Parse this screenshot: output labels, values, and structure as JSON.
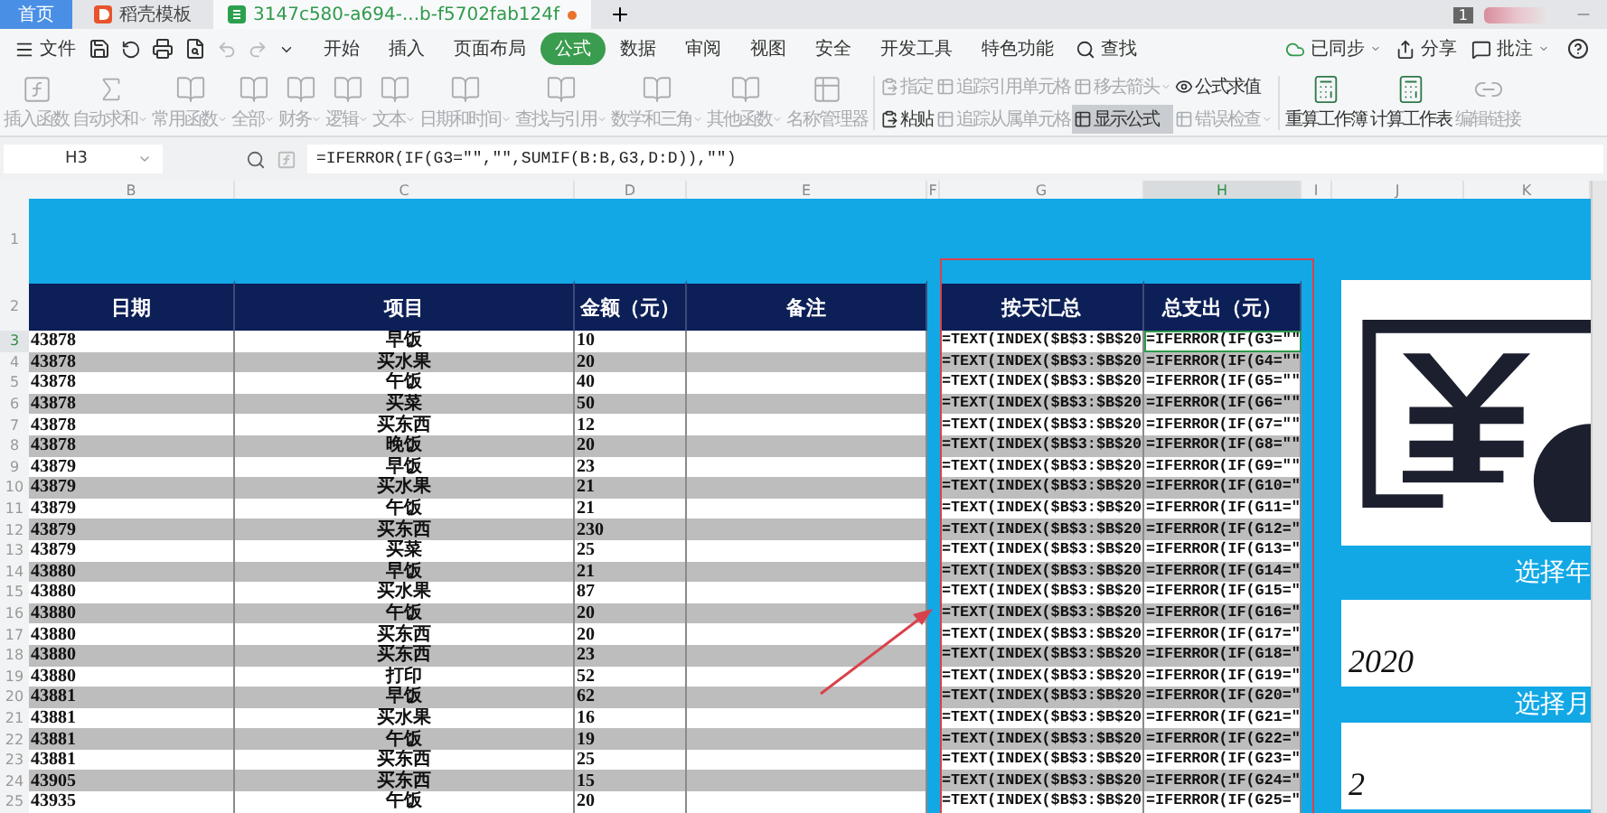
{
  "tabs": [
    {
      "label": "首页",
      "kind": "home",
      "selected": false
    },
    {
      "label": "稻壳模板",
      "kind": "docer",
      "selected": false
    },
    {
      "label": "3147c580-a694-...b-f5702fab124f",
      "kind": "sheet",
      "selected": true
    }
  ],
  "notification_count": "1",
  "menu": {
    "file": "文件",
    "items": [
      {
        "label": "开始",
        "selected": false
      },
      {
        "label": "插入",
        "selected": false
      },
      {
        "label": "页面布局",
        "selected": false
      },
      {
        "label": "公式",
        "selected": true
      },
      {
        "label": "数据",
        "selected": false
      },
      {
        "label": "审阅",
        "selected": false
      },
      {
        "label": "视图",
        "selected": false
      },
      {
        "label": "安全",
        "selected": false
      },
      {
        "label": "开发工具",
        "selected": false
      },
      {
        "label": "特色功能",
        "selected": false
      }
    ],
    "search": "查找",
    "sync": "已同步",
    "share": "分享",
    "comment": "批注"
  },
  "ribbon": [
    {
      "kind": "function",
      "label": "插入函数",
      "dropdown": false,
      "disabled": true
    },
    {
      "kind": "sum",
      "label": "自动求和",
      "dropdown": true,
      "disabled": true
    },
    {
      "kind": "category",
      "label": "常用函数",
      "dropdown": true,
      "disabled": true
    },
    {
      "kind": "category",
      "label": "全部",
      "dropdown": true,
      "disabled": true
    },
    {
      "kind": "category",
      "label": "财务",
      "dropdown": true,
      "disabled": true
    },
    {
      "kind": "category",
      "label": "逻辑",
      "dropdown": true,
      "disabled": true
    },
    {
      "kind": "category",
      "label": "文本",
      "dropdown": true,
      "disabled": true
    },
    {
      "kind": "category",
      "label": "日期和时间",
      "dropdown": true,
      "disabled": true
    },
    {
      "kind": "category",
      "label": "查找与引用",
      "dropdown": true,
      "disabled": true
    },
    {
      "kind": "category",
      "label": "数学和三角",
      "dropdown": true,
      "disabled": true
    },
    {
      "kind": "category",
      "label": "其他函数",
      "dropdown": true,
      "disabled": true
    },
    {
      "kind": "manager",
      "label": "名称管理器",
      "dropdown": false,
      "disabled": true
    }
  ],
  "ribbon_small": [
    [
      {
        "label": "指定",
        "dropdown": false,
        "disabled": true,
        "on": false
      },
      {
        "label": "粘贴",
        "dropdown": false,
        "disabled": false,
        "on": false
      }
    ],
    [
      {
        "label": "追踪引用单元格",
        "dropdown": false,
        "disabled": true,
        "on": false
      },
      {
        "label": "追踪从属单元格",
        "dropdown": false,
        "disabled": true,
        "on": false
      }
    ],
    [
      {
        "label": "移去箭头",
        "dropdown": true,
        "disabled": true,
        "on": false
      },
      {
        "label": "显示公式",
        "dropdown": false,
        "disabled": false,
        "on": true
      }
    ],
    [
      {
        "label": "公式求值",
        "dropdown": false,
        "disabled": false,
        "on": false
      },
      {
        "label": "错误检查",
        "dropdown": true,
        "disabled": true,
        "on": false
      }
    ]
  ],
  "ribbon_end": [
    {
      "kind": "recalc",
      "label": "重算工作簿",
      "dropdown": false,
      "disabled": false
    },
    {
      "kind": "recalc",
      "label": "计算工作表",
      "dropdown": false,
      "disabled": false
    },
    {
      "kind": "link",
      "label": "编辑链接",
      "dropdown": false,
      "disabled": true
    }
  ],
  "formula_bar": {
    "cell": "H3",
    "formula": "=IFERROR(IF(G3=\"\",\"\",SUMIF(B:B,G3,D:D)),\"\")"
  },
  "columns": [
    {
      "label": "B",
      "selected": false
    },
    {
      "label": "C",
      "selected": false
    },
    {
      "label": "D",
      "selected": false
    },
    {
      "label": "E",
      "selected": false
    },
    {
      "label": "F",
      "selected": false
    },
    {
      "label": "G",
      "selected": false
    },
    {
      "label": "H",
      "selected": true
    },
    {
      "label": "I",
      "selected": false
    },
    {
      "label": "J",
      "selected": false
    },
    {
      "label": "K",
      "selected": false
    }
  ],
  "top_rows": [
    "1",
    "2"
  ],
  "headers": [
    "日期",
    "项目",
    "金额（元）",
    "备注"
  ],
  "summary_headers": [
    "按天汇总",
    "总支出（元）"
  ],
  "rows": [
    {
      "number": "3",
      "date": "43878",
      "item": "早饭",
      "amount": "10",
      "day": "=TEXT(INDEX($B$3:$B$20",
      "total": "=IFERROR(IF(G3=\"\"",
      "selected": true
    },
    {
      "number": "4",
      "date": "43878",
      "item": "买水果",
      "amount": "20",
      "day": "=TEXT(INDEX($B$3:$B$20",
      "total": "=IFERROR(IF(G4=\"\"",
      "selected": false
    },
    {
      "number": "5",
      "date": "43878",
      "item": "午饭",
      "amount": "40",
      "day": "=TEXT(INDEX($B$3:$B$20",
      "total": "=IFERROR(IF(G5=\"\"",
      "selected": false
    },
    {
      "number": "6",
      "date": "43878",
      "item": "买菜",
      "amount": "50",
      "day": "=TEXT(INDEX($B$3:$B$20",
      "total": "=IFERROR(IF(G6=\"\"",
      "selected": false
    },
    {
      "number": "7",
      "date": "43878",
      "item": "买东西",
      "amount": "12",
      "day": "=TEXT(INDEX($B$3:$B$20",
      "total": "=IFERROR(IF(G7=\"\"",
      "selected": false
    },
    {
      "number": "8",
      "date": "43878",
      "item": "晚饭",
      "amount": "20",
      "day": "=TEXT(INDEX($B$3:$B$20",
      "total": "=IFERROR(IF(G8=\"\"",
      "selected": false
    },
    {
      "number": "9",
      "date": "43879",
      "item": "早饭",
      "amount": "23",
      "day": "=TEXT(INDEX($B$3:$B$20",
      "total": "=IFERROR(IF(G9=\"\"",
      "selected": false
    },
    {
      "number": "10",
      "date": "43879",
      "item": "买水果",
      "amount": "21",
      "day": "=TEXT(INDEX($B$3:$B$20",
      "total": "=IFERROR(IF(G10=\"",
      "selected": false
    },
    {
      "number": "11",
      "date": "43879",
      "item": "午饭",
      "amount": "21",
      "day": "=TEXT(INDEX($B$3:$B$20",
      "total": "=IFERROR(IF(G11=\"",
      "selected": false
    },
    {
      "number": "12",
      "date": "43879",
      "item": "买东西",
      "amount": "230",
      "day": "=TEXT(INDEX($B$3:$B$20",
      "total": "=IFERROR(IF(G12=\"",
      "selected": false
    },
    {
      "number": "13",
      "date": "43879",
      "item": "买菜",
      "amount": "25",
      "day": "=TEXT(INDEX($B$3:$B$20",
      "total": "=IFERROR(IF(G13=\"",
      "selected": false
    },
    {
      "number": "14",
      "date": "43880",
      "item": "早饭",
      "amount": "21",
      "day": "=TEXT(INDEX($B$3:$B$20",
      "total": "=IFERROR(IF(G14=\"",
      "selected": false
    },
    {
      "number": "15",
      "date": "43880",
      "item": "买水果",
      "amount": "87",
      "day": "=TEXT(INDEX($B$3:$B$20",
      "total": "=IFERROR(IF(G15=\"",
      "selected": false
    },
    {
      "number": "16",
      "date": "43880",
      "item": "午饭",
      "amount": "20",
      "day": "=TEXT(INDEX($B$3:$B$20",
      "total": "=IFERROR(IF(G16=\"",
      "selected": false
    },
    {
      "number": "17",
      "date": "43880",
      "item": "买东西",
      "amount": "20",
      "day": "=TEXT(INDEX($B$3:$B$20",
      "total": "=IFERROR(IF(G17=\"",
      "selected": false
    },
    {
      "number": "18",
      "date": "43880",
      "item": "买东西",
      "amount": "23",
      "day": "=TEXT(INDEX($B$3:$B$20",
      "total": "=IFERROR(IF(G18=\"",
      "selected": false
    },
    {
      "number": "19",
      "date": "43880",
      "item": "打印",
      "amount": "52",
      "day": "=TEXT(INDEX($B$3:$B$20",
      "total": "=IFERROR(IF(G19=\"",
      "selected": false
    },
    {
      "number": "20",
      "date": "43881",
      "item": "早饭",
      "amount": "62",
      "day": "=TEXT(INDEX($B$3:$B$20",
      "total": "=IFERROR(IF(G20=\"",
      "selected": false
    },
    {
      "number": "21",
      "date": "43881",
      "item": "买水果",
      "amount": "16",
      "day": "=TEXT(INDEX($B$3:$B$20",
      "total": "=IFERROR(IF(G21=\"",
      "selected": false
    },
    {
      "number": "22",
      "date": "43881",
      "item": "午饭",
      "amount": "19",
      "day": "=TEXT(INDEX($B$3:$B$20",
      "total": "=IFERROR(IF(G22=\"",
      "selected": false
    },
    {
      "number": "23",
      "date": "43881",
      "item": "买东西",
      "amount": "25",
      "day": "=TEXT(INDEX($B$3:$B$20",
      "total": "=IFERROR(IF(G23=\"",
      "selected": false
    },
    {
      "number": "24",
      "date": "43905",
      "item": "买东西",
      "amount": "15",
      "day": "=TEXT(INDEX($B$3:$B$20",
      "total": "=IFERROR(IF(G24=\"",
      "selected": false
    },
    {
      "number": "25",
      "date": "43935",
      "item": "午饭",
      "amount": "20",
      "day": "=TEXT(INDEX($B$3:$B$20",
      "total": "=IFERROR(IF(G25=\"",
      "selected": false
    }
  ],
  "side_panel": {
    "year_label": "选择年",
    "year": "2020",
    "month_label": "选择月",
    "month": "2"
  }
}
